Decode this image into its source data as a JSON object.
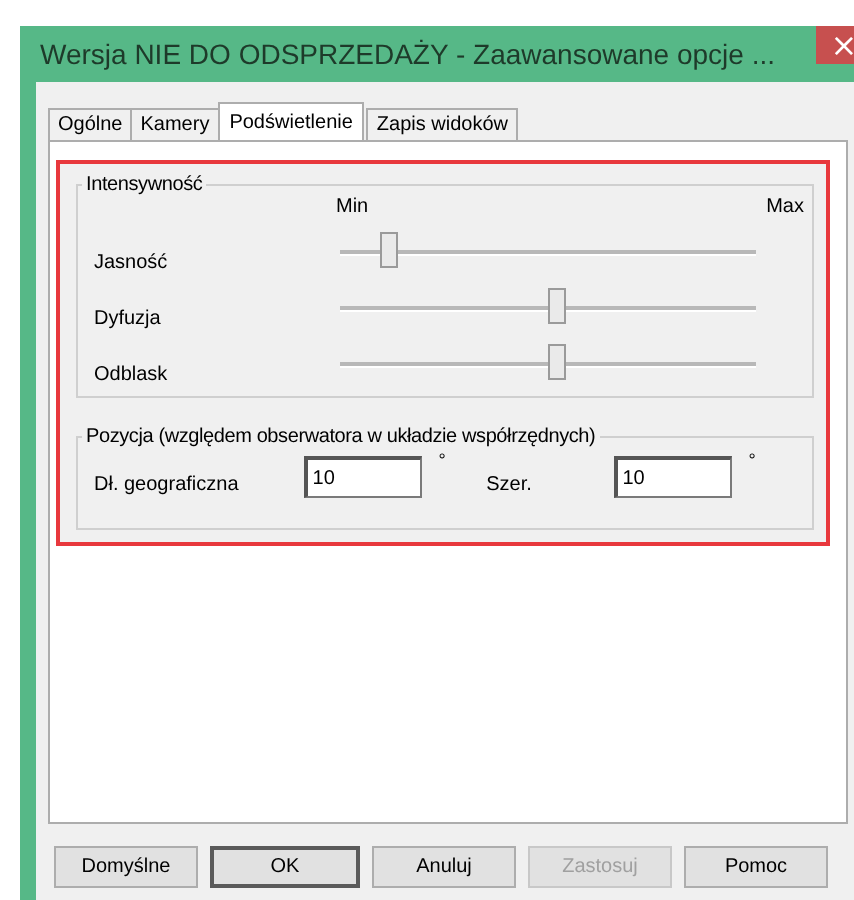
{
  "window": {
    "title": "Wersja NIE DO ODSPRZEDAŻY - Zaawansowane opcje ...",
    "close": "×"
  },
  "tabs": [
    {
      "label": "Ogólne",
      "selected": false
    },
    {
      "label": "Kamery",
      "selected": false
    },
    {
      "label": "Podświetlenie",
      "selected": true
    },
    {
      "label": "Zapis widoków",
      "selected": false
    }
  ],
  "intensity": {
    "title": "Intensywność",
    "min_label": "Min",
    "max_label": "Max",
    "sliders": [
      {
        "name": "Jasność",
        "level": 0.1
      },
      {
        "name": "Dyfuzja",
        "level": 0.52
      },
      {
        "name": "Odblask",
        "level": 0.52
      }
    ]
  },
  "position": {
    "title": "Pozycja (względem obserwatora w układzie współrzędnych)",
    "fields": [
      {
        "label": "Dł. geograficzna",
        "value": "10",
        "unit": "°"
      },
      {
        "label": "Szer.",
        "value": "10",
        "unit": "°"
      }
    ]
  },
  "buttons": [
    {
      "label": "Domyślne",
      "disabled": false,
      "default": false
    },
    {
      "label": "OK",
      "disabled": false,
      "default": true
    },
    {
      "label": "Anuluj",
      "disabled": false,
      "default": false
    },
    {
      "label": "Zastosuj",
      "disabled": true,
      "default": false
    },
    {
      "label": "Pomoc",
      "disabled": false,
      "default": false
    }
  ]
}
